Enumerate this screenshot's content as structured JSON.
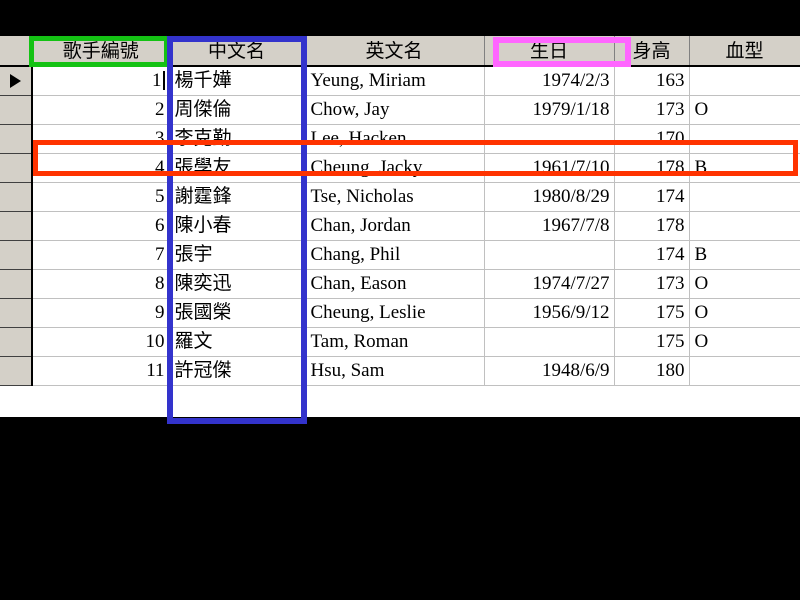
{
  "window": {
    "background_color": "#000000",
    "app_type": "database-datasheet"
  },
  "table": {
    "columns": [
      {
        "key": "selector",
        "label": "",
        "align": "center"
      },
      {
        "key": "singer_id",
        "label": "歌手編號",
        "align": "right"
      },
      {
        "key": "chinese_name",
        "label": "中文名",
        "align": "left"
      },
      {
        "key": "english_name",
        "label": "英文名",
        "align": "left"
      },
      {
        "key": "birthday",
        "label": "生日",
        "align": "right"
      },
      {
        "key": "height",
        "label": "身高",
        "align": "right"
      },
      {
        "key": "blood_type",
        "label": "血型",
        "align": "left"
      }
    ],
    "rows": [
      {
        "selector": "▶",
        "singer_id": "1",
        "chinese_name": "楊千嬅",
        "english_name": "Yeung, Miriam",
        "birthday": "1974/2/3",
        "height": "163",
        "blood_type": "",
        "current": true
      },
      {
        "selector": "",
        "singer_id": "2",
        "chinese_name": "周傑倫",
        "english_name": "Chow, Jay",
        "birthday": "1979/1/18",
        "height": "173",
        "blood_type": "O",
        "current": false
      },
      {
        "selector": "",
        "singer_id": "3",
        "chinese_name": "李克勤",
        "english_name": "Lee, Hacken",
        "birthday": "",
        "height": "170",
        "blood_type": "",
        "current": false
      },
      {
        "selector": "",
        "singer_id": "4",
        "chinese_name": "張學友",
        "english_name": "Cheung, Jacky",
        "birthday": "1961/7/10",
        "height": "178",
        "blood_type": "B",
        "current": false
      },
      {
        "selector": "",
        "singer_id": "5",
        "chinese_name": "謝霆鋒",
        "english_name": "Tse, Nicholas",
        "birthday": "1980/8/29",
        "height": "174",
        "blood_type": "",
        "current": false
      },
      {
        "selector": "",
        "singer_id": "6",
        "chinese_name": "陳小春",
        "english_name": "Chan, Jordan",
        "birthday": "1967/7/8",
        "height": "178",
        "blood_type": "",
        "current": false
      },
      {
        "selector": "",
        "singer_id": "7",
        "chinese_name": "張宇",
        "english_name": "Chang, Phil",
        "birthday": "",
        "height": "174",
        "blood_type": "B",
        "current": false
      },
      {
        "selector": "",
        "singer_id": "8",
        "chinese_name": "陳奕迅",
        "english_name": "Chan, Eason",
        "birthday": "1974/7/27",
        "height": "173",
        "blood_type": "O",
        "current": false
      },
      {
        "selector": "",
        "singer_id": "9",
        "chinese_name": "張國榮",
        "english_name": "Cheung, Leslie",
        "birthday": "1956/9/12",
        "height": "175",
        "blood_type": "O",
        "current": false
      },
      {
        "selector": "",
        "singer_id": "10",
        "chinese_name": "羅文",
        "english_name": "Tam, Roman",
        "birthday": "",
        "height": "175",
        "blood_type": "O",
        "current": false
      },
      {
        "selector": "",
        "singer_id": "11",
        "chinese_name": "許冠傑",
        "english_name": "Hsu, Sam",
        "birthday": "1948/6/9",
        "height": "180",
        "blood_type": "",
        "current": false
      }
    ]
  },
  "annotations": [
    {
      "name": "green-header-highlight",
      "target": "歌手編號",
      "color": "#14c214",
      "shape": "rectangle"
    },
    {
      "name": "blue-column-highlight",
      "target": "中文名",
      "color": "#3333cc",
      "shape": "rectangle"
    },
    {
      "name": "pink-header-highlight",
      "target": "生日",
      "color": "#ff66ff",
      "shape": "rectangle"
    },
    {
      "name": "red-row-highlight",
      "target": "3 李克勤 Lee, Hacken",
      "color": "#ff3300",
      "shape": "rectangle"
    }
  ]
}
